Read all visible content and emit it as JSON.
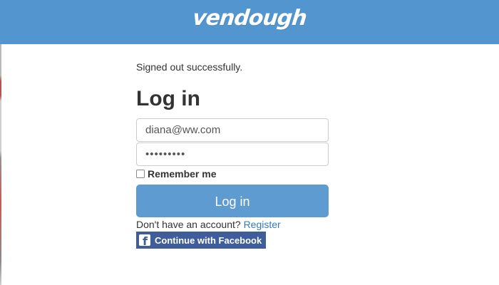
{
  "header": {
    "logo_text": "vendough"
  },
  "main": {
    "flash_message": "Signed out successfully.",
    "title": "Log in",
    "email": {
      "value": "diana@ww.com",
      "placeholder": ""
    },
    "password": {
      "value": "•••••••••",
      "placeholder": ""
    },
    "remember_label": "Remember me",
    "submit_label": "Log in",
    "signup_prompt": "Don't have an account?",
    "register_link": "Register",
    "facebook_button": "Continue with Facebook",
    "facebook_icon": "facebook-icon"
  },
  "colors": {
    "header": "#5395cf",
    "primary_button": "#5d9bd1",
    "link": "#337ab7",
    "facebook": "#3f5c9b"
  }
}
